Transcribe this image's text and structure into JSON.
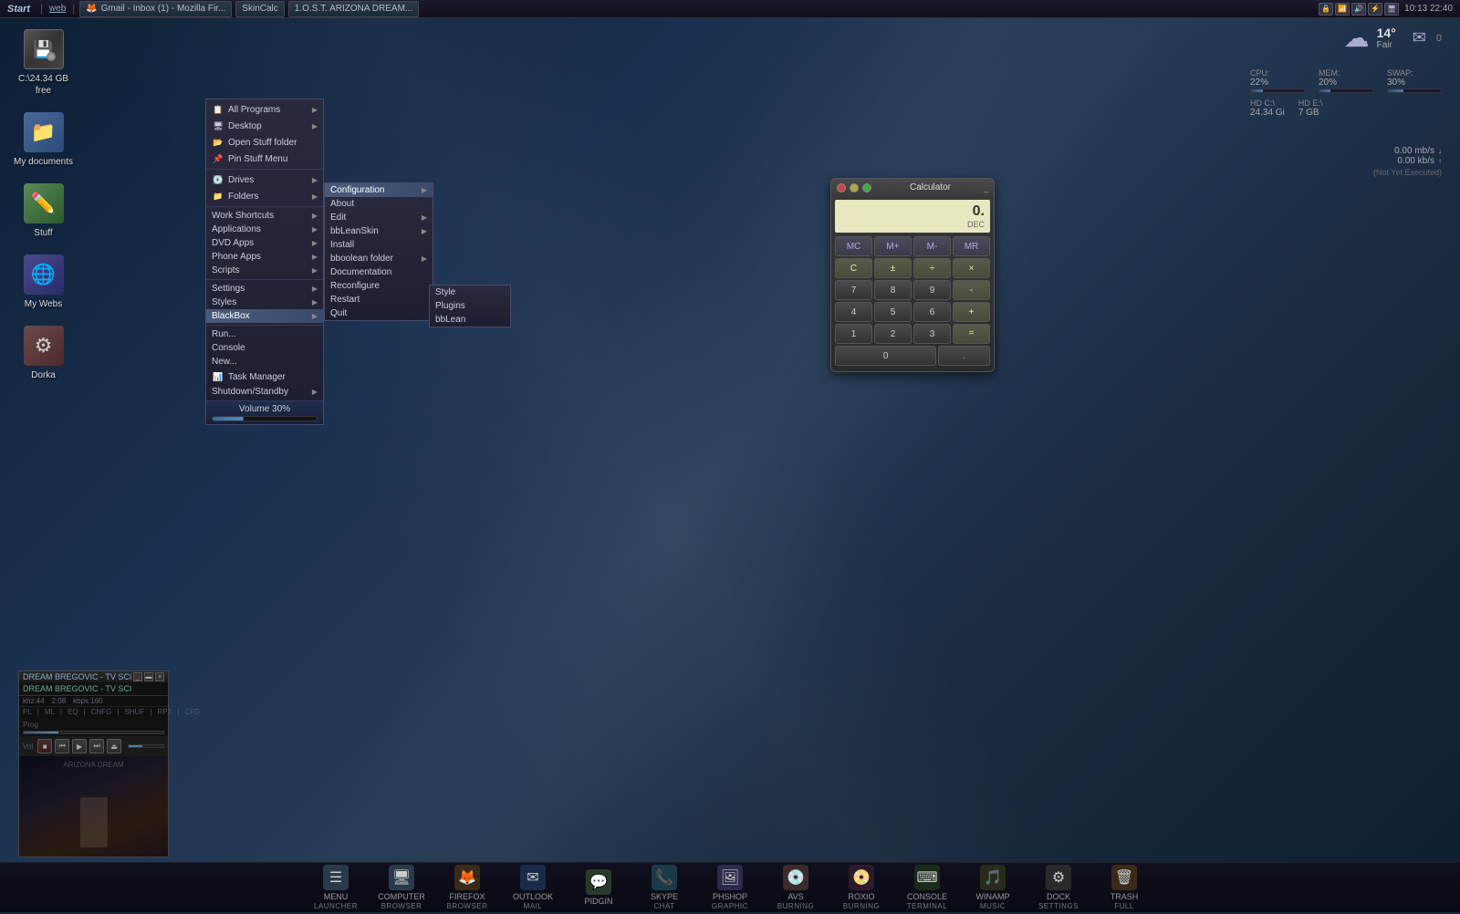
{
  "taskbar": {
    "start_label": "Start",
    "divider": "|",
    "web_label": "web",
    "windows": [
      {
        "label": "Gmail - Inbox (1) - Mozilla Fir...",
        "icon": "🦊",
        "active": false
      },
      {
        "label": "SkinCalc",
        "active": false
      },
      {
        "label": "1.O.S.T. ARIZONA DREAM...",
        "active": false
      }
    ],
    "time": "10:13  22:40"
  },
  "weather": {
    "temp": "14°",
    "desc": "Fair",
    "icon": "☁"
  },
  "stats": {
    "cpu_label": "CPU:",
    "cpu_value": "22%",
    "mem_label": "MEM:",
    "mem_value": "20%",
    "swap_label": "SWAP:",
    "swap_value": "30%",
    "hdc_label": "HD C:\\",
    "hdc_value": "24.34 Gi",
    "hde_label": "HD E:\\",
    "hde_value": "7 GB",
    "net_down": "0.00 mb/s",
    "net_up": "0.00 kb/s",
    "net_status": "(Not Yet Executed)"
  },
  "desktop_icons": [
    {
      "label": "C:\\24.34 GB free",
      "type": "hdd"
    },
    {
      "label": "My documents",
      "type": "folder"
    },
    {
      "label": "Stuff",
      "type": "stuff"
    },
    {
      "label": "My Webs",
      "type": "globe"
    },
    {
      "label": "Dorka",
      "type": "dorka"
    }
  ],
  "start_menu": {
    "items_top": [
      {
        "label": "All Programs",
        "arrow": true
      },
      {
        "label": "Desktop",
        "arrow": true
      },
      {
        "label": "Open Stuff folder"
      },
      {
        "label": "Pin Stuff Menu"
      }
    ],
    "items_mid1": [
      {
        "label": "Drives",
        "arrow": true
      },
      {
        "label": "Folders",
        "arrow": true
      }
    ],
    "items_mid2": [
      {
        "label": "Work Shortcuts",
        "arrow": true
      },
      {
        "label": "Applications",
        "arrow": true
      },
      {
        "label": "DVD Apps",
        "arrow": true
      },
      {
        "label": "Phone Apps",
        "arrow": true
      },
      {
        "label": "Scripts",
        "arrow": true
      }
    ],
    "items_mid3": [
      {
        "label": "Settings",
        "arrow": true
      },
      {
        "label": "Styles",
        "arrow": true
      },
      {
        "label": "BlackBox",
        "arrow": true,
        "active": true
      }
    ],
    "items_bot": [
      {
        "label": "Run..."
      },
      {
        "label": "Console"
      },
      {
        "label": "New..."
      },
      {
        "label": "Task Manager"
      },
      {
        "label": "Shutdown/Standby",
        "arrow": true
      }
    ],
    "volume_label": "Volume 30%"
  },
  "submenu_config": {
    "items": [
      {
        "label": "Configuration",
        "arrow": true,
        "active": true
      },
      {
        "label": "About"
      },
      {
        "label": "Edit",
        "arrow": true
      },
      {
        "label": "bbLeanSkin",
        "arrow": true
      },
      {
        "label": "Install"
      },
      {
        "label": "bboolean folder",
        "arrow": true
      },
      {
        "label": "Documentation"
      },
      {
        "label": "Reconfigure"
      },
      {
        "label": "Restart"
      },
      {
        "label": "Quit"
      }
    ]
  },
  "submenu_style": {
    "items": [
      {
        "label": "Style"
      },
      {
        "label": "Plugins"
      },
      {
        "label": "bbLean"
      }
    ]
  },
  "calculator": {
    "title": "Calculator",
    "display": "0.",
    "mode": "DEC",
    "buttons_row1": [
      "MC",
      "M+",
      "M-",
      "MR"
    ],
    "buttons_row2": [
      "C",
      "±",
      "÷",
      "×"
    ],
    "buttons_row3": [
      "7",
      "8",
      "9",
      "-"
    ],
    "buttons_row4": [
      "4",
      "5",
      "6",
      "+"
    ],
    "buttons_row5": [
      "1",
      "2",
      "3"
    ],
    "buttons_row6": [
      "0",
      ".",
      "="
    ]
  },
  "media_player": {
    "title": "DREAM BREGOVIC - TV SCI",
    "khz": "khz:44",
    "time": "2:08",
    "kbps": "kbps:160",
    "links": [
      "PL",
      "ML",
      "EQ",
      "CNFG",
      "SHUF",
      "RPT",
      "CFD"
    ],
    "prog_label": "Prog",
    "vol_label": "Vol"
  },
  "bottom_dock": [
    {
      "main": "MENU",
      "sub": "LAUNCHER",
      "icon": "☰"
    },
    {
      "main": "COMPUTER",
      "sub": "BROWSER",
      "icon": "🖥"
    },
    {
      "main": "FIREFOX",
      "sub": "BROWSER",
      "icon": "🌐"
    },
    {
      "main": "OUTLOOK",
      "sub": "MAIL",
      "icon": "✉"
    },
    {
      "main": "PIDGIN",
      "sub": "",
      "icon": "💬"
    },
    {
      "main": "SKYPE",
      "sub": "CHAT",
      "icon": "📞"
    },
    {
      "main": "PHSHOP",
      "sub": "GRAPHIC",
      "icon": "🖼"
    },
    {
      "main": "AVS",
      "sub": "BURNING",
      "icon": "💿"
    },
    {
      "main": "ROXIO",
      "sub": "BURNING",
      "icon": "📀"
    },
    {
      "main": "CONSOLE",
      "sub": "TERMINAL",
      "icon": "⌨"
    },
    {
      "main": "WINAMP",
      "sub": "MUSIC",
      "icon": "🎵"
    },
    {
      "main": "DOCK",
      "sub": "SETTINGS",
      "icon": "⚙"
    },
    {
      "main": "TRASH",
      "sub": "FULL",
      "icon": "🗑"
    }
  ]
}
